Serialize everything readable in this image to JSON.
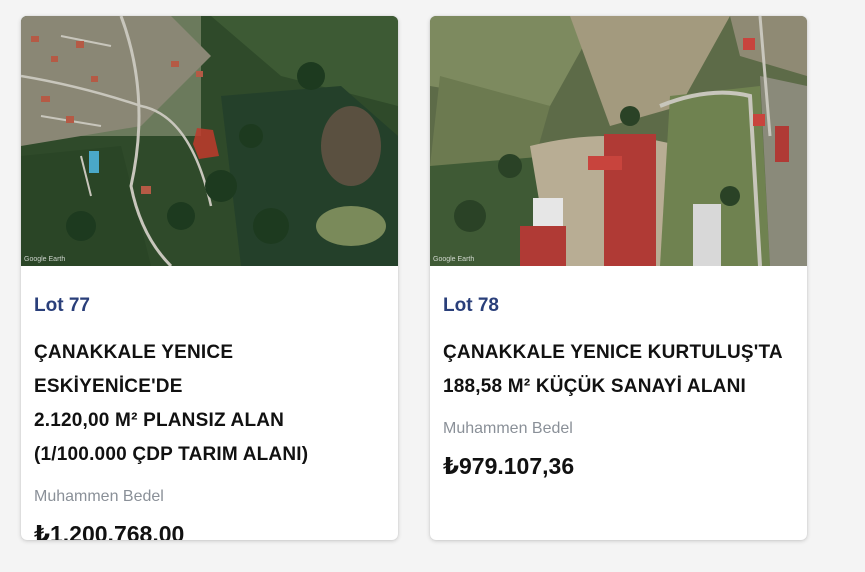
{
  "listings": [
    {
      "lot": "Lot 77",
      "title_lines": [
        "ÇANAKKALE YENICE ESKİYENİCE'DE",
        "2.120,00 M² PLANSIZ ALAN",
        "(1/100.000 ÇDP TARIM ALANI)"
      ],
      "price_label": "Muhammen Bedel",
      "price": "₺1.200.768,00",
      "image_credit": "Google Earth",
      "image_alt": "Aerial satellite view"
    },
    {
      "lot": "Lot 78",
      "title_lines": [
        "ÇANAKKALE YENICE KURTULUŞ'TA",
        "188,58 M² KÜÇÜK SANAYİ ALANI"
      ],
      "price_label": "Muhammen Bedel",
      "price": "₺979.107,36",
      "image_credit": "Google Earth",
      "image_alt": "Aerial satellite view"
    }
  ],
  "colors": {
    "lot_accent": "#2a3f7a",
    "label_gray": "#8a9098",
    "background": "#f4f4f4"
  }
}
